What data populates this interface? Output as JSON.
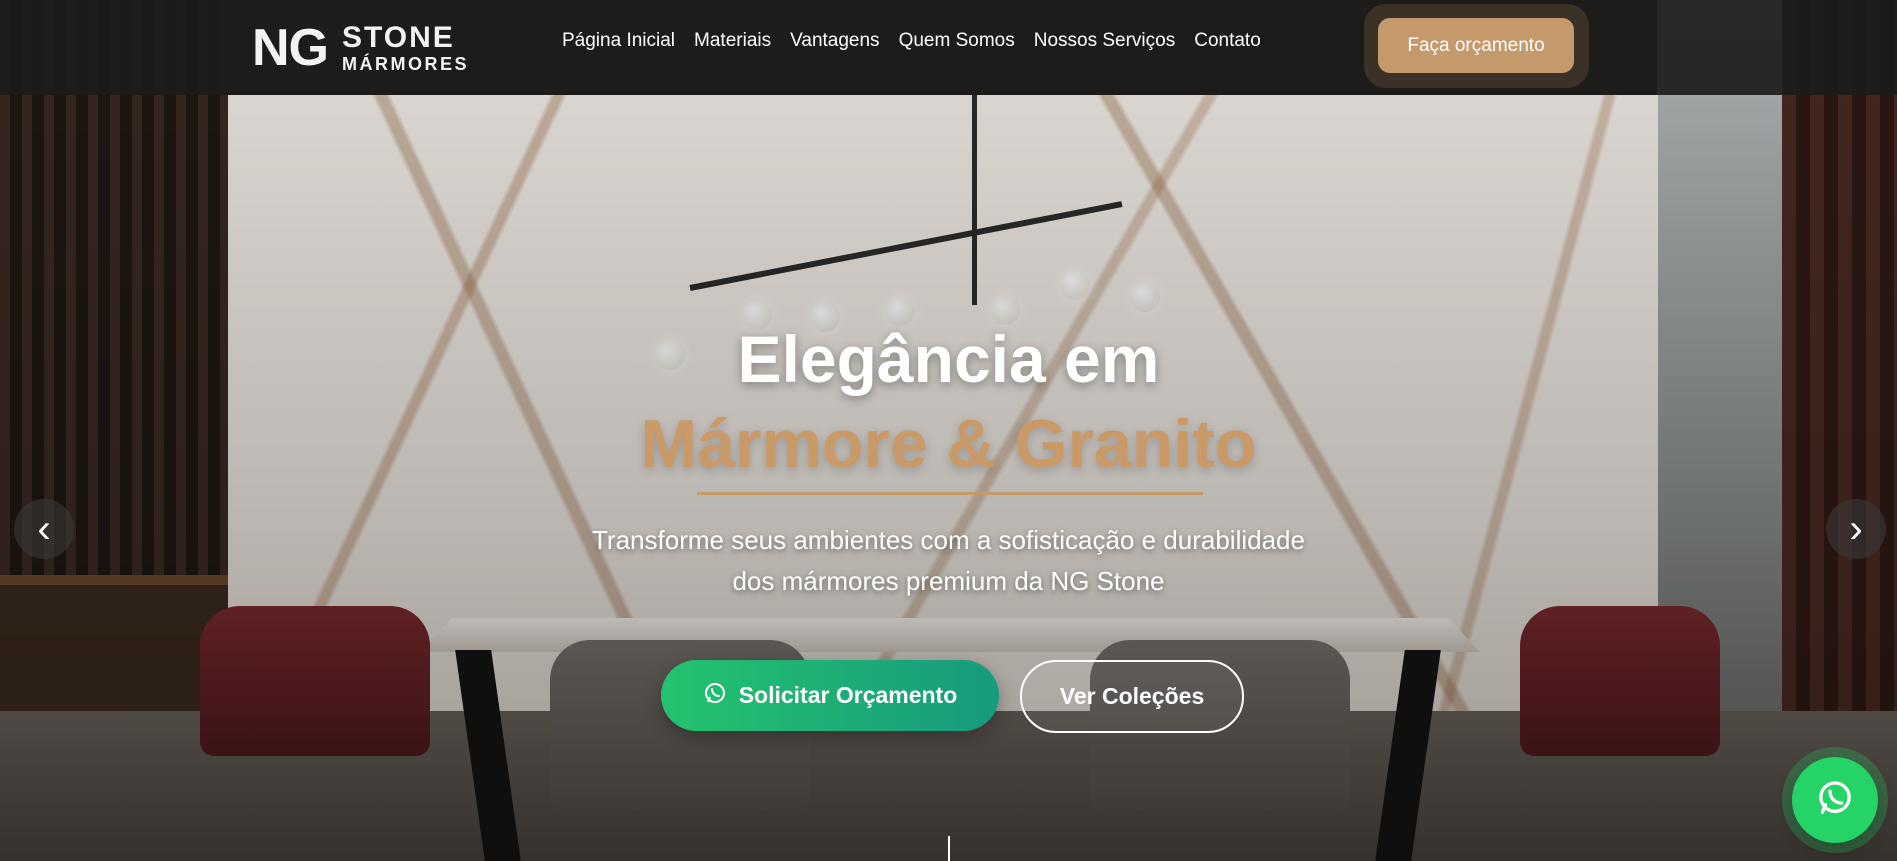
{
  "header": {
    "logo": {
      "ng": "NG",
      "stone": "STONE",
      "marmores": "MÁRMORES"
    },
    "nav": [
      {
        "label": "Página Inicial"
      },
      {
        "label": "Materiais"
      },
      {
        "label": "Vantagens"
      },
      {
        "label": "Quem Somos"
      },
      {
        "label": "Nossos Serviços"
      },
      {
        "label": "Contato"
      }
    ],
    "cta_label": "Faça orçamento"
  },
  "hero": {
    "title_line1": "Elegância em",
    "title_line2": "Mármore & Granito",
    "subtitle_line1": "Transforme seus ambientes com a sofisticação e durabilidade",
    "subtitle_line2": "dos mármores premium da NG Stone",
    "primary_button": {
      "label": "Solicitar Orçamento",
      "icon": "whatsapp-icon"
    },
    "secondary_button": {
      "label": "Ver Coleções"
    },
    "prev_arrow": "‹",
    "next_arrow": "›"
  },
  "colors": {
    "accent": "#c49a6c",
    "whatsapp": "#25d366",
    "header_bg": "#1c1c1b"
  }
}
